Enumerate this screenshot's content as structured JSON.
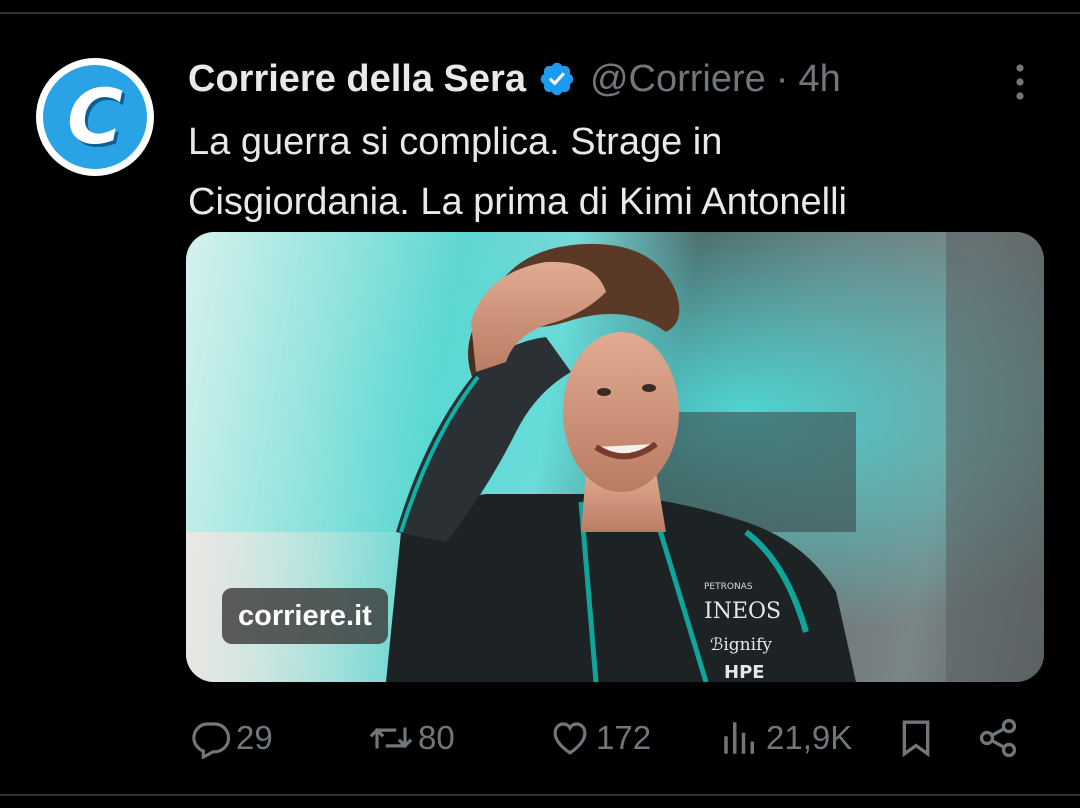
{
  "account": {
    "display_name": "Corriere della Sera",
    "handle": "@Corriere",
    "separator": "·",
    "time": "4h",
    "avatar_letter": "C",
    "verified": true
  },
  "tweet": {
    "line1": "La guerra si complica. Strage in",
    "line2": "Cisgiordania. La prima di Kimi Antonelli"
  },
  "media": {
    "source": "corriere.it",
    "suit_texts": [
      "INEOS",
      "ℬignify",
      "HPE",
      "PETRONAS"
    ]
  },
  "actions": {
    "replies": "29",
    "reposts": "80",
    "likes": "172",
    "views": "21,9K"
  },
  "colors": {
    "background": "#000000",
    "text": "#e7e9ea",
    "muted": "#71767b",
    "verified": "#1d9bf0",
    "avatar": "#2aa3e6"
  }
}
